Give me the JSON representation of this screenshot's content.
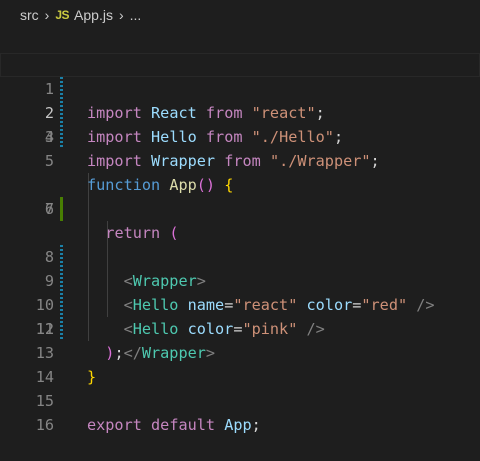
{
  "breadcrumb": {
    "folder": "src",
    "file_icon": "JS",
    "file": "App.js",
    "symbol": "..."
  },
  "editor": {
    "current_line": 2,
    "line_numbers": [
      "1",
      "2",
      "3",
      "4",
      "5",
      "6",
      "7",
      "8",
      "9",
      "10",
      "11",
      "12",
      "13",
      "14",
      "15",
      "16"
    ],
    "lines": [
      [
        "import",
        " ",
        "React",
        " ",
        "from",
        " ",
        "\"react\"",
        ";"
      ],
      [
        "import",
        " ",
        "Hello",
        " ",
        "from",
        " ",
        "\"./Hello\"",
        ";"
      ],
      [
        "import",
        " ",
        "Wrapper",
        " ",
        "from",
        " ",
        "\"./Wrapper\"",
        ";"
      ],
      [],
      [
        "function",
        " ",
        "App",
        "(",
        ")",
        " ",
        "{"
      ],
      [],
      [
        "  ",
        "return",
        " ",
        "("
      ],
      [
        "    ",
        "<",
        "Wrapper",
        ">"
      ],
      [
        "    ",
        "<",
        "Hello",
        " ",
        "name",
        "=",
        "\"react\"",
        " ",
        "color",
        "=",
        "\"red\"",
        " ",
        "/>"
      ],
      [
        "    ",
        "<",
        "Hello",
        " ",
        "color",
        "=",
        "\"pink\"",
        " ",
        "/>"
      ],
      [
        "    ",
        "</",
        "Wrapper",
        ">"
      ],
      [
        "  ",
        ")",
        ";"
      ],
      [
        "}"
      ],
      [],
      [
        "export",
        " ",
        "default",
        " ",
        "App",
        ";"
      ],
      []
    ],
    "git_gutter": {
      "modified_lines": [
        1,
        2,
        3,
        8,
        9,
        10,
        11
      ],
      "added_lines": [
        6
      ],
      "colors": {
        "modified": "#1b81a8",
        "added": "#487e02"
      }
    }
  },
  "theme_colors": {
    "background": "#1e1e1e",
    "keyword_blue": "#569cd6",
    "keyword_purple": "#c586c0",
    "string": "#ce9178",
    "function": "#dcdcaa",
    "variable": "#9cdcfe",
    "component": "#4ec9b0",
    "tag_bracket": "#808080",
    "bracket_gold": "#ffd700",
    "bracket_pink": "#da70d6"
  }
}
